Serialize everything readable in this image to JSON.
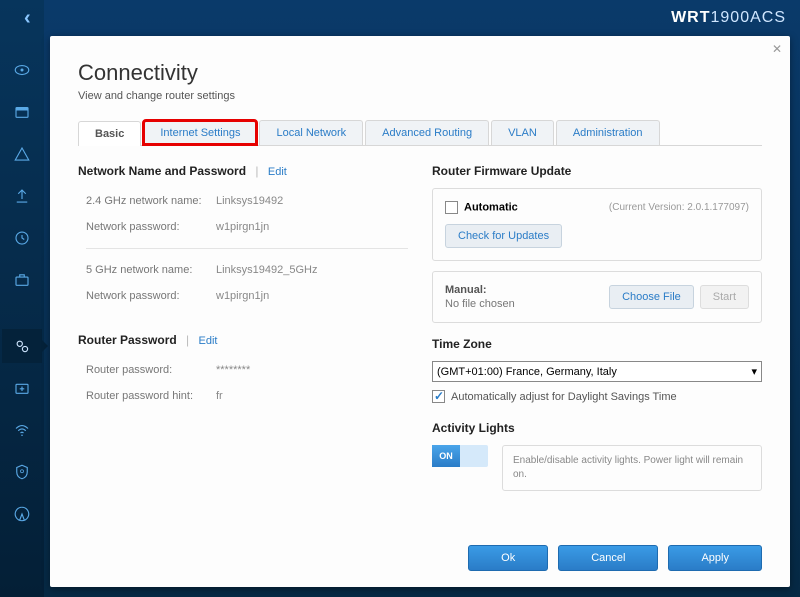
{
  "brand": {
    "bold": "WRT",
    "model": "1900ACS"
  },
  "page": {
    "title": "Connectivity",
    "subtitle": "View and change router settings"
  },
  "tabs": [
    "Basic",
    "Internet Settings",
    "Local Network",
    "Advanced Routing",
    "VLAN",
    "Administration"
  ],
  "network": {
    "header": "Network Name and Password",
    "edit": "Edit",
    "rows24": {
      "nameLabel": "2.4 GHz network name:",
      "nameValue": "Linksys19492",
      "pwLabel": "Network password:",
      "pwValue": "w1pirgn1jn"
    },
    "rows5": {
      "nameLabel": "5 GHz network name:",
      "nameValue": "Linksys19492_5GHz",
      "pwLabel": "Network password:",
      "pwValue": "w1pirgn1jn"
    }
  },
  "routerPw": {
    "header": "Router Password",
    "edit": "Edit",
    "pwLabel": "Router password:",
    "pwValue": "********",
    "hintLabel": "Router password hint:",
    "hintValue": "fr"
  },
  "firmware": {
    "header": "Router Firmware Update",
    "autoLabel": "Automatic",
    "version": "(Current Version: 2.0.1.177097)",
    "checkBtn": "Check for Updates",
    "manualLabel": "Manual:",
    "noFile": "No file chosen",
    "chooseBtn": "Choose File",
    "startBtn": "Start"
  },
  "timezone": {
    "header": "Time Zone",
    "selected": "(GMT+01:00) France, Germany, Italy",
    "dst": "Automatically adjust for Daylight Savings Time"
  },
  "activity": {
    "header": "Activity Lights",
    "toggle": "ON",
    "desc": "Enable/disable activity lights. Power light will remain on."
  },
  "footer": {
    "ok": "Ok",
    "cancel": "Cancel",
    "apply": "Apply"
  }
}
